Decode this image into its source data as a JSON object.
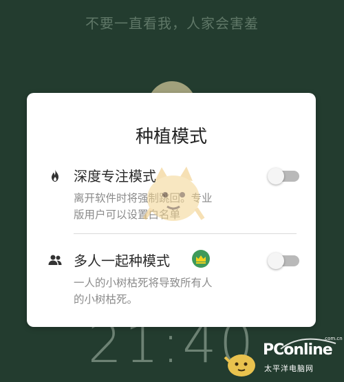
{
  "background": {
    "hint_text": "不要一直看我，人家会害羞",
    "clock": "21:40"
  },
  "dialog": {
    "title": "种植模式",
    "modes": [
      {
        "icon": "fire-icon",
        "title": "深度专注模式",
        "description_line1": "离开软件时将强制跳回。专业",
        "description_line2": "版用户可以设置白名单",
        "toggle_on": false
      },
      {
        "icon": "people-icon",
        "title": "多人一起种模式",
        "badge_icon": "crown-icon",
        "description_line1": "一人的小树枯死将导致所有人",
        "description_line2": "的小树枯死。",
        "toggle_on": false
      }
    ]
  },
  "watermark": {
    "logo": "PConline",
    "url": ".com.cn",
    "subtitle": "太平洋电脑网"
  },
  "colors": {
    "background": "#233c2f",
    "dialog": "#ffffff",
    "toggle_track": "#b9b9b9",
    "badge": "#3e9a5a"
  }
}
